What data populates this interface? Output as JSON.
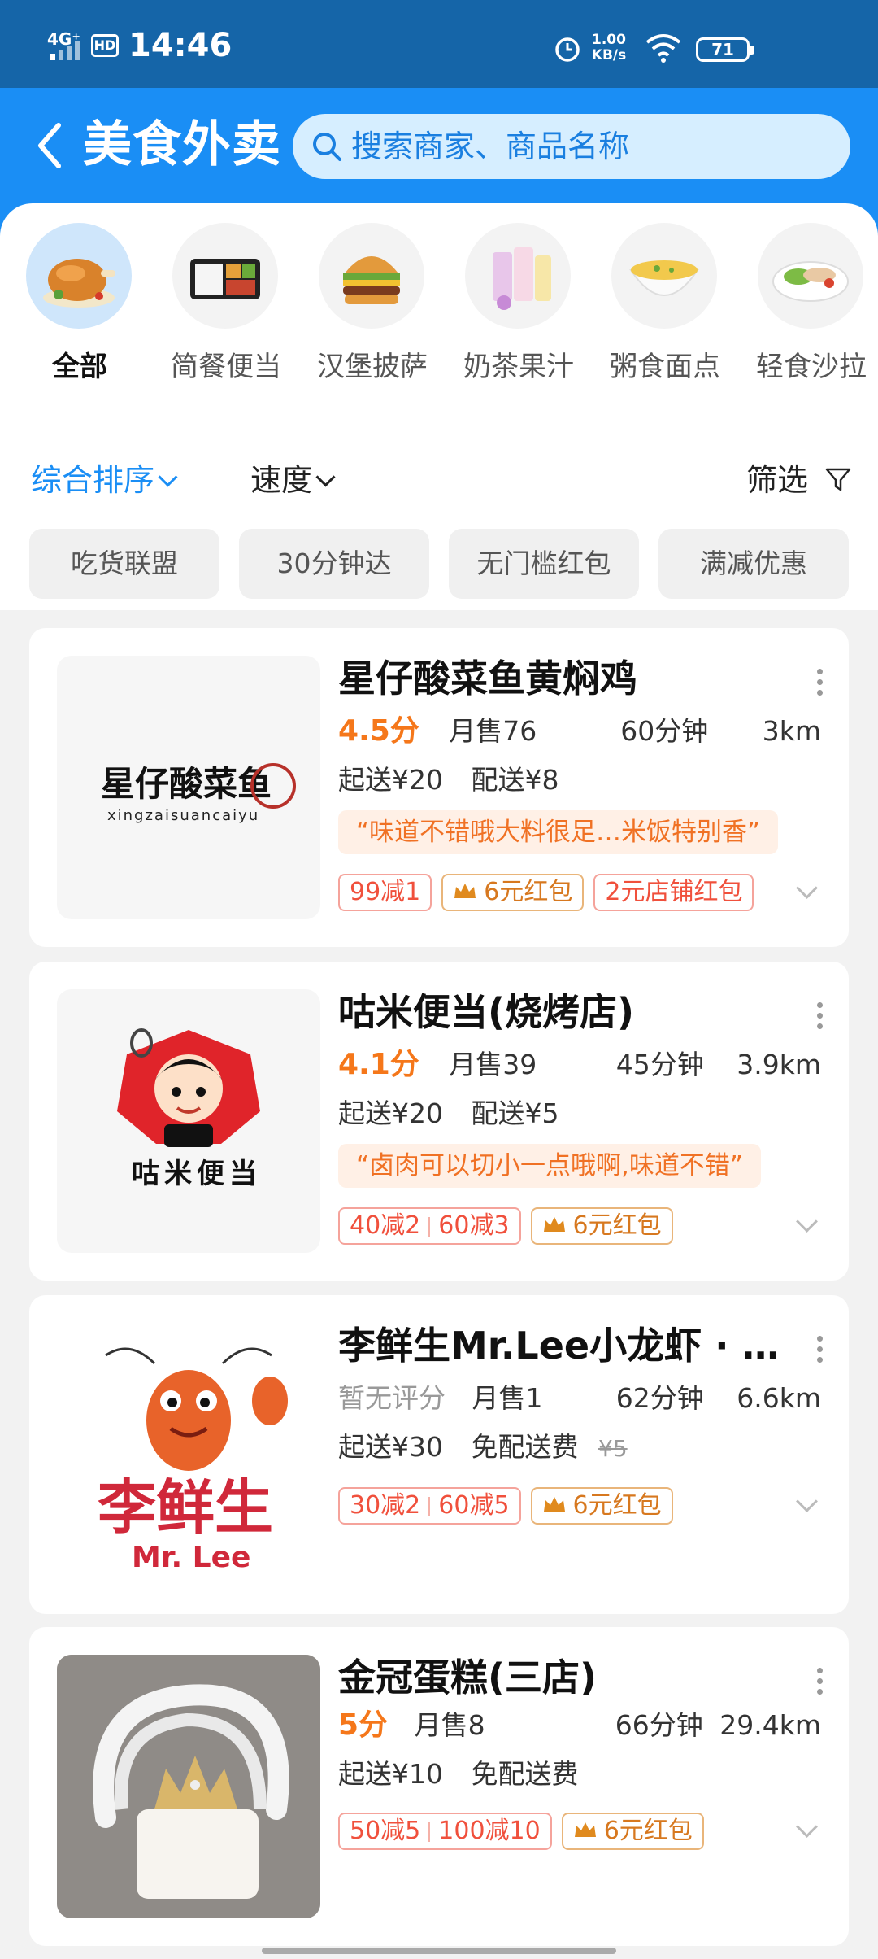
{
  "status_bar": {
    "network": "4G⁺",
    "hd": "HD",
    "time": "14:46",
    "speed_value": "1.00",
    "speed_unit": "KB/s",
    "battery": "71"
  },
  "header": {
    "title": "美食外卖",
    "search_placeholder": "搜索商家、商品名称"
  },
  "categories": [
    {
      "label": "全部",
      "icon": "roast-chicken",
      "active": true
    },
    {
      "label": "简餐便当",
      "icon": "bento-box"
    },
    {
      "label": "汉堡披萨",
      "icon": "burger"
    },
    {
      "label": "奶茶果汁",
      "icon": "milk-tea"
    },
    {
      "label": "粥食面点",
      "icon": "porridge-bowl"
    },
    {
      "label": "轻食沙拉",
      "icon": "salad"
    }
  ],
  "sort": {
    "general": "综合排序",
    "speed": "速度",
    "filter": "筛选"
  },
  "chips": [
    "吃货联盟",
    "30分钟达",
    "无门槛红包",
    "满减优惠"
  ],
  "stores": [
    {
      "name": "星仔酸菜鱼黄焖鸡",
      "logo_text": "星仔酸菜鱼",
      "logo_sub": "xingzaisuancaiyu",
      "score": "4.5分",
      "monthly_sales": "月售76",
      "time": "60分钟",
      "distance": "3km",
      "min_order": "起送¥20",
      "delivery_fee": "配送¥8",
      "original_fee": "",
      "review": "“味道不错哦大料很足…米饭特别香”",
      "discounts": [
        "99减1"
      ],
      "red_packet": "6元红包",
      "shop_red_packet": "2元店铺红包"
    },
    {
      "name": "咕米便当(烧烤店)",
      "logo_text": "咕米便当",
      "score": "4.1分",
      "monthly_sales": "月售39",
      "time": "45分钟",
      "distance": "3.9km",
      "min_order": "起送¥20",
      "delivery_fee": "配送¥5",
      "original_fee": "",
      "review": "“卤肉可以切小一点哦啊,味道不错”",
      "discounts": [
        "40减2",
        "60减3"
      ],
      "red_packet": "6元红包"
    },
    {
      "name": "李鲜生Mr.Lee小龙虾 · …",
      "logo_text": "李鲜生",
      "logo_sub": "Mr. Lee",
      "score": "暂无评分",
      "monthly_sales": "月售1",
      "time": "62分钟",
      "distance": "6.6km",
      "min_order": "起送¥30",
      "delivery_fee": "免配送费",
      "original_fee": "¥5",
      "discounts": [
        "30减2",
        "60减5"
      ],
      "red_packet": "6元红包"
    },
    {
      "name": "金冠蛋糕(三店)",
      "score": "5分",
      "monthly_sales": "月售8",
      "time": "66分钟",
      "distance": "29.4km",
      "min_order": "起送¥10",
      "delivery_fee": "免配送费",
      "original_fee": "",
      "discounts": [
        "50减5",
        "100减10"
      ],
      "red_packet": "6元红包"
    }
  ],
  "colors": {
    "header_blue": "#1a8ef5",
    "status_blue": "#1565a8",
    "accent_orange": "#f5771a",
    "discount_red": "#f0503c",
    "gold": "#d7781f"
  }
}
